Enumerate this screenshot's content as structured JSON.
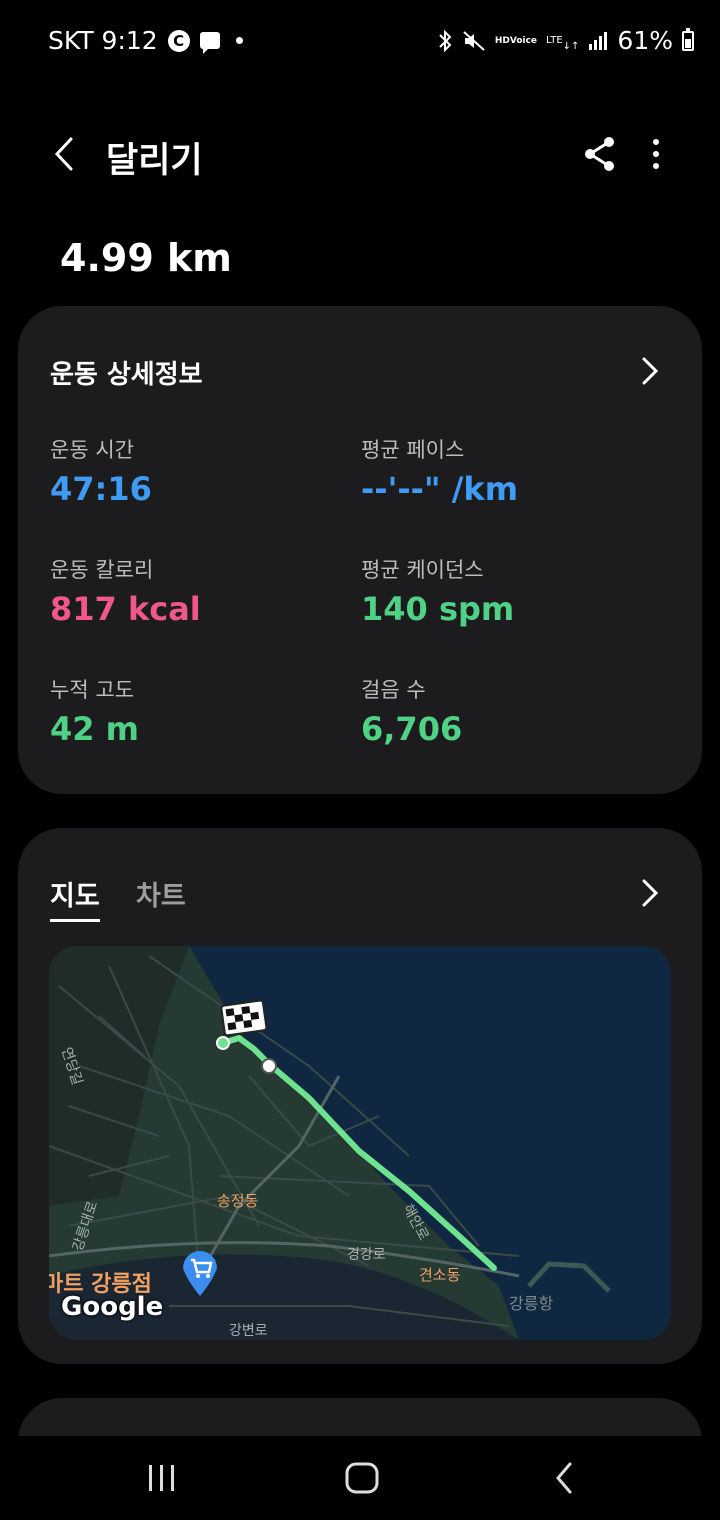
{
  "status_bar": {
    "carrier_time": "SKT 9:12",
    "c_icon": "C",
    "hd_top": "HD",
    "hd_bottom": "Voice",
    "lte": "LTE",
    "battery": "61%"
  },
  "app_bar": {
    "title": "달리기"
  },
  "distance": "4.99 km",
  "details": {
    "title": "운동 상세정보",
    "stats": [
      {
        "label": "운동 시간",
        "value": "47:16",
        "color": "#3f9cf6"
      },
      {
        "label": "평균 페이스",
        "value": "--'--\" /km",
        "color": "#3f9cf6"
      },
      {
        "label": "운동 칼로리",
        "value": "817 kcal",
        "color": "#f0588a"
      },
      {
        "label": "평균 케이던스",
        "value": "140 spm",
        "color": "#4fd286"
      },
      {
        "label": "누적 고도",
        "value": "42 m",
        "color": "#4fd286"
      },
      {
        "label": "걸음 수",
        "value": "6,706",
        "color": "#4fd286"
      }
    ]
  },
  "map_section": {
    "tabs": [
      "지도",
      "차트"
    ],
    "selected_tab": "지도",
    "map": {
      "labels": [
        "연당길",
        "강릉대로",
        "송정동",
        "경강로",
        "해안로",
        "견소동",
        "강릉항",
        "강변로"
      ],
      "store": "마트 강릉점",
      "logo": "Google"
    }
  },
  "colors": {
    "background": "#000000",
    "card": "#1c1c1e",
    "route": "#6ee28e",
    "sea": "#0f2741"
  }
}
